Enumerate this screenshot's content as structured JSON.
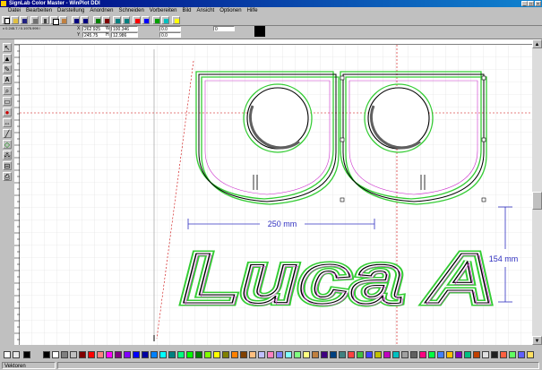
{
  "window": {
    "title": "SignLab Color Master - WinPlot DDI",
    "minimize": "_",
    "maximize": "□",
    "close": "×"
  },
  "menu": [
    "Datei",
    "Bearbeiten",
    "Darstellung",
    "Anordnen",
    "Schneiden",
    "Vorbereiten",
    "Bild",
    "Ansicht",
    "Optionen",
    "Hilfe"
  ],
  "status_left": "x 0.245.7 / 0.1975.999 / ",
  "props": {
    "x_label": "X",
    "y_label": "Y",
    "w_label": "W",
    "h_label": "H",
    "x_val": "262.925",
    "y_val": "245.75",
    "w_val": "100.346",
    "h_val": "12.986",
    "angle1": "0.0",
    "angle2": "0.0",
    "scale": "0"
  },
  "drawing": {
    "dim_horizontal": "250 mm",
    "dim_vertical": "154 mm",
    "text": "Luca A"
  },
  "statusbar": {
    "text": "Vektoren"
  },
  "palette": [
    "#000000",
    "#ffffff",
    "#808080",
    "#c0c0c0",
    "#800000",
    "#ff0000",
    "#ff8080",
    "#ff00ff",
    "#800080",
    "#8000ff",
    "#0000ff",
    "#0000a0",
    "#0080ff",
    "#00ffff",
    "#008080",
    "#00ff80",
    "#00ff00",
    "#008000",
    "#80ff00",
    "#ffff00",
    "#808000",
    "#ff8000",
    "#804000",
    "#ffc080",
    "#c0c0ff",
    "#ff80c0",
    "#8080ff",
    "#80ffff",
    "#80ff80",
    "#ffff80",
    "#c08040",
    "#400080",
    "#004080",
    "#408080",
    "#ff4040",
    "#40c040",
    "#4040ff",
    "#c0c000",
    "#c000c0",
    "#00c0c0",
    "#a0a0a0",
    "#606060",
    "#ff0080",
    "#00ff40",
    "#4080ff",
    "#ffc000",
    "#8000c0",
    "#00c080",
    "#c04000",
    "#e0e0e0",
    "#202020",
    "#ff6040",
    "#60ff60",
    "#6060ff",
    "#ffe060"
  ],
  "colors": {
    "outline": "#000000",
    "contour": "#33cc33",
    "dimension": "#3030c0",
    "guide": "#cc0000",
    "grid": "#dcdcdc"
  }
}
